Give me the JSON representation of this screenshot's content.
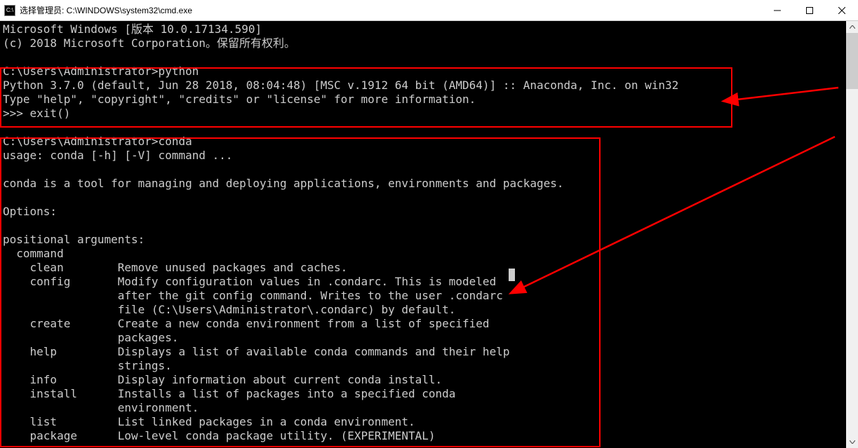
{
  "window": {
    "title": "选择管理员: C:\\WINDOWS\\system32\\cmd.exe",
    "icon_label": "C:\\"
  },
  "terminal": {
    "header1": "Microsoft Windows [版本 10.0.17134.590]",
    "header2": "(c) 2018 Microsoft Corporation。保留所有权利。",
    "blank": "",
    "prompt1": "C:\\Users\\Administrator>python",
    "py_ver": "Python 3.7.0 (default, Jun 28 2018, 08:04:48) [MSC v.1912 64 bit (AMD64)] :: Anaconda, Inc. on win32",
    "py_help": "Type \"help\", \"copyright\", \"credits\" or \"license\" for more information.",
    "py_exit": ">>> exit()",
    "prompt2": "C:\\Users\\Administrator>conda",
    "usage": "usage: conda [-h] [-V] command ...",
    "desc": "conda is a tool for managing and deploying applications, environments and packages.",
    "options": "Options:",
    "posargs": "positional arguments:",
    "command": "  command",
    "clean": "    clean        Remove unused packages and caches.",
    "config1": "    config       Modify configuration values in .condarc. This is modeled",
    "config2": "                 after the git config command. Writes to the user .condarc",
    "config3": "                 file (C:\\Users\\Administrator\\.condarc) by default.",
    "create1": "    create       Create a new conda environment from a list of specified",
    "create2": "                 packages.",
    "help1": "    help         Displays a list of available conda commands and their help",
    "help2": "                 strings.",
    "info": "    info         Display information about current conda install.",
    "install1": "    install      Installs a list of packages into a specified conda",
    "install2": "                 environment.",
    "list": "    list         List linked packages in a conda environment.",
    "package": "    package      Low-level conda package utility. (EXPERIMENTAL)"
  }
}
